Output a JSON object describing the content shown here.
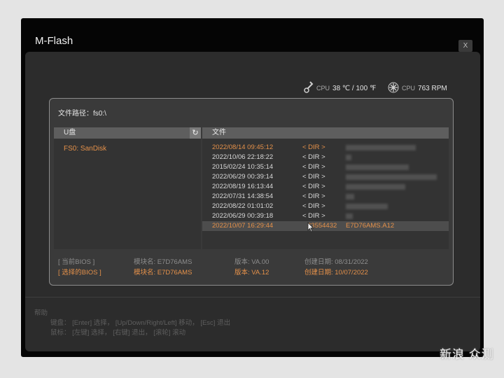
{
  "window": {
    "title": "M-Flash",
    "close_label": "X"
  },
  "status": {
    "cpu_temp_label": "CPU",
    "cpu_temp_value": "38 ℃ / 100 ℉",
    "cpu_fan_label": "CPU",
    "cpu_fan_value": "763 RPM"
  },
  "dialog": {
    "path_label": "文件路径：fs0:\\",
    "drive_panel_header": "U盘",
    "drive_item": "FS0: SanDisk",
    "file_panel_header": "文件",
    "files": [
      {
        "date": "2022/08/14 09:45:12",
        "type": "< DIR >",
        "name": ""
      },
      {
        "date": "2022/10/06 22:18:22",
        "type": "< DIR >",
        "name": ""
      },
      {
        "date": "2015/02/24 10:35:14",
        "type": "< DIR >",
        "name": ""
      },
      {
        "date": "2022/06/29 00:39:14",
        "type": "< DIR >",
        "name": ""
      },
      {
        "date": "2022/08/19 16:13:44",
        "type": "< DIR >",
        "name": ""
      },
      {
        "date": "2022/07/31 14:38:54",
        "type": "< DIR >",
        "name": ""
      },
      {
        "date": "2022/08/22 01:01:02",
        "type": "< DIR >",
        "name": ""
      },
      {
        "date": "2022/06/29 00:39:18",
        "type": "< DIR >",
        "name": ""
      },
      {
        "date": "2022/10/07 16:29:44",
        "type": "33554432",
        "name": "E7D76AMS.A12"
      }
    ],
    "bios": {
      "current": {
        "label": "[   当前BIOS    ]",
        "module": "模块名: E7D76AMS",
        "version": "版本: VA.00",
        "date": "创建日期: 08/31/2022"
      },
      "selected": {
        "label": "[   选择的BIOS   ]",
        "module": "模块名: E7D76AMS",
        "version": "版本: VA.12",
        "date": "创建日期: 10/07/2022"
      }
    }
  },
  "help": {
    "title": "帮助",
    "keyboard": "键盘： [Enter] 选择， [Up/Down/Right/Left] 移动， [Esc] 退出",
    "mouse": "鼠标： [左键] 选择， [右键] 退出， [滚轮] 滚动"
  },
  "watermark": "新浪 众测",
  "colors": {
    "accent": "#e5914a",
    "background": "#2c2c2c",
    "header": "#5e5e5e"
  }
}
